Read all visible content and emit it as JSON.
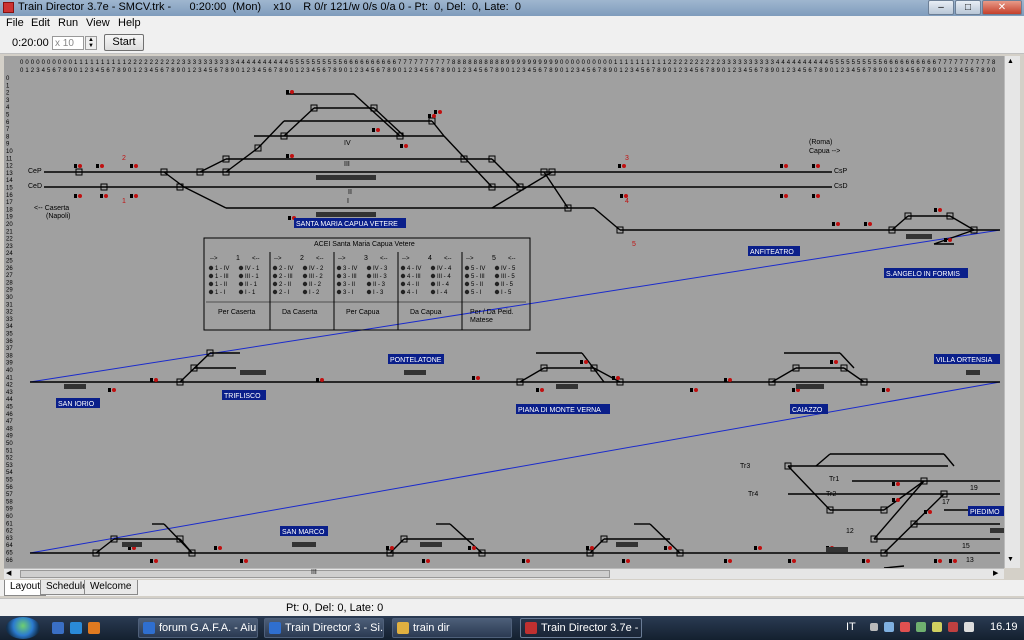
{
  "window": {
    "title": "Train Director 3.7e - SMCV.trk -      0:20:00  (Mon)    x10    R 0/r 121/w 0/s 0/a 0 - Pt:  0, Del:  0, Late:  0",
    "minimize_label": "–",
    "maximize_label": "□",
    "close_label": "✕"
  },
  "menu": [
    "File",
    "Edit",
    "Run",
    "View",
    "Help"
  ],
  "toolbar": {
    "time": "0:20:00",
    "speed_placeholder": "x 10",
    "start_label": "Start"
  },
  "layout": {
    "tens_digits": "0000000000111111111122222222223333333333444444444455555555556666666666777777777788888888889999999999000000000011111111112222222222333333333344444444445555555555666666666677777777778",
    "units_digits": "0123456789012345678901234567890123456789012345678901234567890123456789012345678901234567890123456789012345678901234567890123456789012345678901234567890123456789012345678901234567890",
    "stations": [
      "SANTA MARIA CAPUA VETERE",
      "ANFITEATRO",
      "S.ANGELO IN FORMIS",
      "PONTELATONE",
      "VILLA ORTENSIA",
      "SAN IORIO",
      "TRIFLISCO",
      "PIANA DI MONTE VERNA",
      "CAIAZZO",
      "SAN MARCO",
      "PIEDIMO"
    ],
    "labels": {
      "cep": "CeP",
      "ced": "CeD",
      "csp": "CsP",
      "csd": "CsD",
      "caserta": "<-- Caserta",
      "napoli": "(Napoli)",
      "roma": "(Roma)",
      "capua": "Capua  -->",
      "track_iv": "IV",
      "track_iii": "III",
      "track_ii": "II",
      "track_i": "I",
      "n1": "1",
      "n2": "2",
      "n3": "3",
      "n4": "4",
      "n5": "5",
      "tr3": "Tr3",
      "tr4": "Tr4",
      "tr1": "Tr1",
      "tr2": "Tr2",
      "n12": "12",
      "n13": "13",
      "n15": "15",
      "n17": "17",
      "n19": "19"
    },
    "acei": {
      "title": "ACEI Santa Maria Capua Vetere",
      "columns": [
        {
          "num": "1",
          "items": [
            [
              "1 - IV",
              "IV - 1"
            ],
            [
              "1 - III",
              "III - 1"
            ],
            [
              "1 - II",
              "II - 1"
            ],
            [
              "1 - I",
              "I - 1"
            ]
          ],
          "footer": "Per Caserta"
        },
        {
          "num": "2",
          "items": [
            [
              "2 - IV",
              "IV - 2"
            ],
            [
              "2 - III",
              "III - 2"
            ],
            [
              "2 - II",
              "II - 2"
            ],
            [
              "2 - I",
              "I - 2"
            ]
          ],
          "footer": "Da Caserta"
        },
        {
          "num": "3",
          "items": [
            [
              "3 - IV",
              "IV - 3"
            ],
            [
              "3 - III",
              "III - 3"
            ],
            [
              "3 - II",
              "II - 3"
            ],
            [
              "3 - I",
              "I - 3"
            ]
          ],
          "footer": "Per Capua"
        },
        {
          "num": "4",
          "items": [
            [
              "4 - IV",
              "IV - 4"
            ],
            [
              "4 - III",
              "III - 4"
            ],
            [
              "4 - II",
              "II - 4"
            ],
            [
              "4 - I",
              "I - 4"
            ]
          ],
          "footer": "Da Capua"
        },
        {
          "num": "5",
          "items": [
            [
              "5 - IV",
              "IV - 5"
            ],
            [
              "5 - III",
              "III - 5"
            ],
            [
              "5 - II",
              "II - 5"
            ],
            [
              "5 - I",
              "I - 5"
            ]
          ],
          "footer": "Per / Da Peid.\nMatese"
        }
      ],
      "arrow_left": "-->",
      "arrow_right": "<--"
    },
    "scroll_marker": "III"
  },
  "tabs": [
    "Layout",
    "Schedule",
    "Welcome"
  ],
  "active_tab": "Layout",
  "status": "Pt:  0, Del:  0, Late:  0",
  "taskbar": {
    "buttons": [
      {
        "label": "forum G.A.F.A. - Aiu...",
        "icon_color": "#2f6fd0"
      },
      {
        "label": "Train Director 3 - Si...",
        "icon_color": "#2f6fd0"
      },
      {
        "label": "train dir",
        "icon_color": "#e0b040"
      },
      {
        "label": "Train Director 3.7e - ...",
        "icon_color": "#c03030"
      }
    ],
    "lang": "IT",
    "clock": "16.19"
  },
  "colors": {
    "background": "#a0a0a0",
    "track": "#000000",
    "signal_red": "#c01010",
    "station_label_bg": "#0a1f8a",
    "diagonal": "#1a2acc"
  }
}
